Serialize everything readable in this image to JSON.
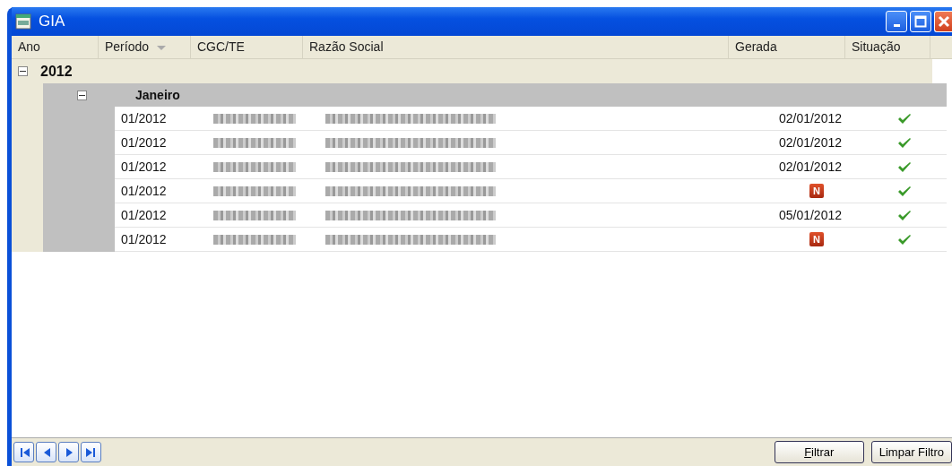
{
  "window": {
    "title": "GIA"
  },
  "columns": [
    {
      "label": "Ano",
      "sorted": false
    },
    {
      "label": "Período",
      "sorted": true
    },
    {
      "label": "CGC/TE",
      "sorted": false
    },
    {
      "label": "Razão Social",
      "sorted": false
    },
    {
      "label": "Gerada",
      "sorted": false
    },
    {
      "label": "Situação",
      "sorted": false
    }
  ],
  "groups": [
    {
      "label": "2012",
      "expanded": true,
      "children": [
        {
          "label": "Janeiro",
          "expanded": true,
          "rows": [
            {
              "periodo": "01/2012",
              "gerada": {
                "kind": "date",
                "text": "02/01/2012"
              },
              "ok": true
            },
            {
              "periodo": "01/2012",
              "gerada": {
                "kind": "date",
                "text": "02/01/2012"
              },
              "ok": true
            },
            {
              "periodo": "01/2012",
              "gerada": {
                "kind": "date",
                "text": "02/01/2012"
              },
              "ok": true
            },
            {
              "periodo": "01/2012",
              "gerada": {
                "kind": "badge",
                "text": "N"
              },
              "ok": true
            },
            {
              "periodo": "01/2012",
              "gerada": {
                "kind": "date",
                "text": "05/01/2012"
              },
              "ok": true
            },
            {
              "periodo": "01/2012",
              "gerada": {
                "kind": "badge",
                "text": "N"
              },
              "ok": true
            }
          ]
        }
      ]
    }
  ],
  "footer": {
    "buttons": [
      {
        "label": "Filtrar"
      },
      {
        "label": "Limpar Filtro"
      }
    ]
  }
}
